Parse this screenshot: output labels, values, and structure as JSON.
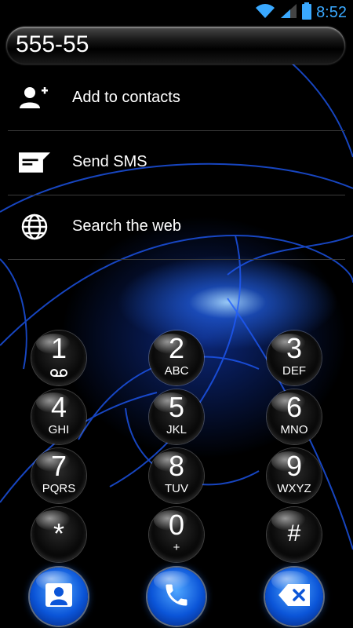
{
  "status_bar": {
    "time": "8:52",
    "icons": [
      "wifi-icon",
      "cell-signal-icon",
      "battery-icon"
    ]
  },
  "dialer": {
    "number": "555-55"
  },
  "options": [
    {
      "label": "Add to contacts",
      "icon": "add-contact-icon"
    },
    {
      "label": "Send SMS",
      "icon": "sms-icon"
    },
    {
      "label": "Search the web",
      "icon": "globe-icon"
    }
  ],
  "keypad": {
    "keys": [
      {
        "digit": "1",
        "sub": ""
      },
      {
        "digit": "2",
        "sub": "ABC"
      },
      {
        "digit": "3",
        "sub": "DEF"
      },
      {
        "digit": "4",
        "sub": "GHI"
      },
      {
        "digit": "5",
        "sub": "JKL"
      },
      {
        "digit": "6",
        "sub": "MNO"
      },
      {
        "digit": "7",
        "sub": "PQRS"
      },
      {
        "digit": "8",
        "sub": "TUV"
      },
      {
        "digit": "9",
        "sub": "WXYZ"
      },
      {
        "digit": "*",
        "sub": ""
      },
      {
        "digit": "0",
        "sub": "+"
      },
      {
        "digit": "#",
        "sub": ""
      }
    ]
  },
  "actions": [
    "contacts-icon",
    "call-icon",
    "backspace-icon"
  ],
  "colors": {
    "accent": "#3aa9ff",
    "button_blue": "#0b55d8",
    "background": "#000000"
  }
}
